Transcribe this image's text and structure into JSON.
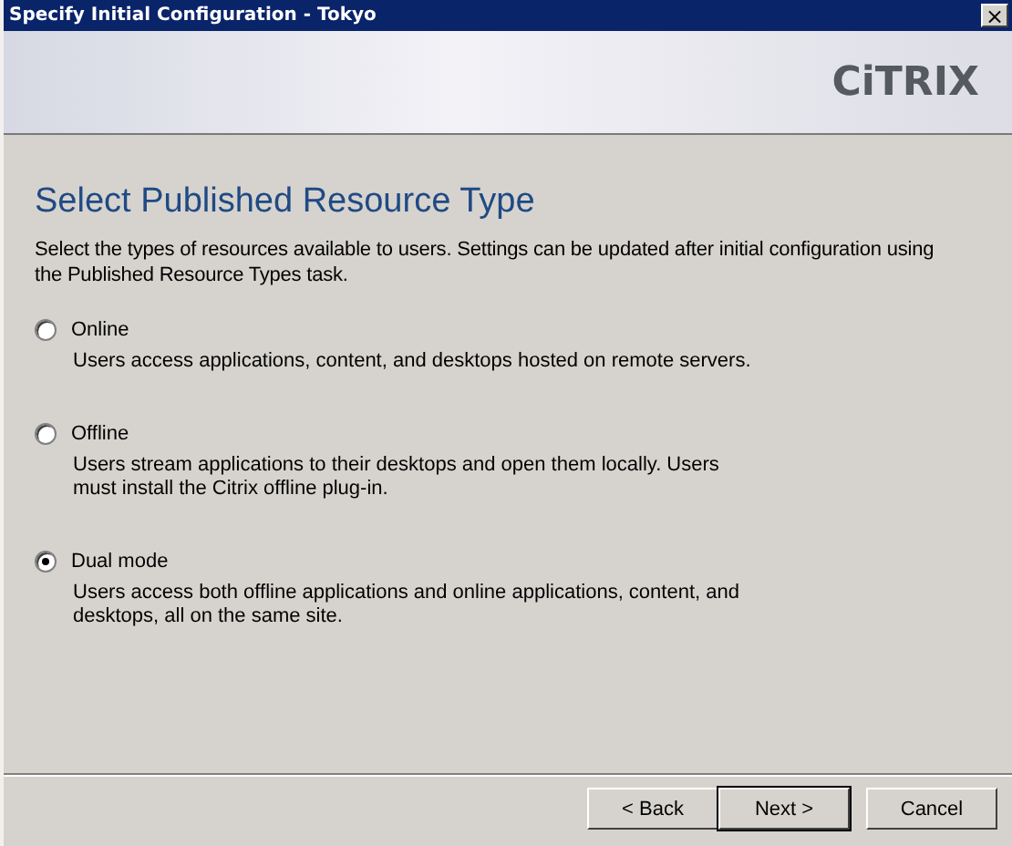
{
  "window": {
    "title": "Specify Initial Configuration - Tokyo",
    "close": "×"
  },
  "header": {
    "logo": "CiTRIX"
  },
  "page": {
    "heading": "Select Published Resource Type",
    "description": "Select the types of resources available to users. Settings can be updated after initial configuration using the Published Resource Types task."
  },
  "options": [
    {
      "label": "Online",
      "description": "Users access applications, content, and desktops hosted on remote servers.",
      "selected": false
    },
    {
      "label": "Offline",
      "description": "Users stream applications to their desktops and open them locally. Users must install the Citrix offline plug-in.",
      "selected": false
    },
    {
      "label": "Dual mode",
      "description": "Users access both offline applications and online applications, content, and desktops, all on the same site.",
      "selected": true
    }
  ],
  "buttons": [
    {
      "label": "< Back",
      "default": false
    },
    {
      "label": "Next >",
      "default": true
    },
    {
      "label": "Cancel",
      "default": false
    }
  ]
}
